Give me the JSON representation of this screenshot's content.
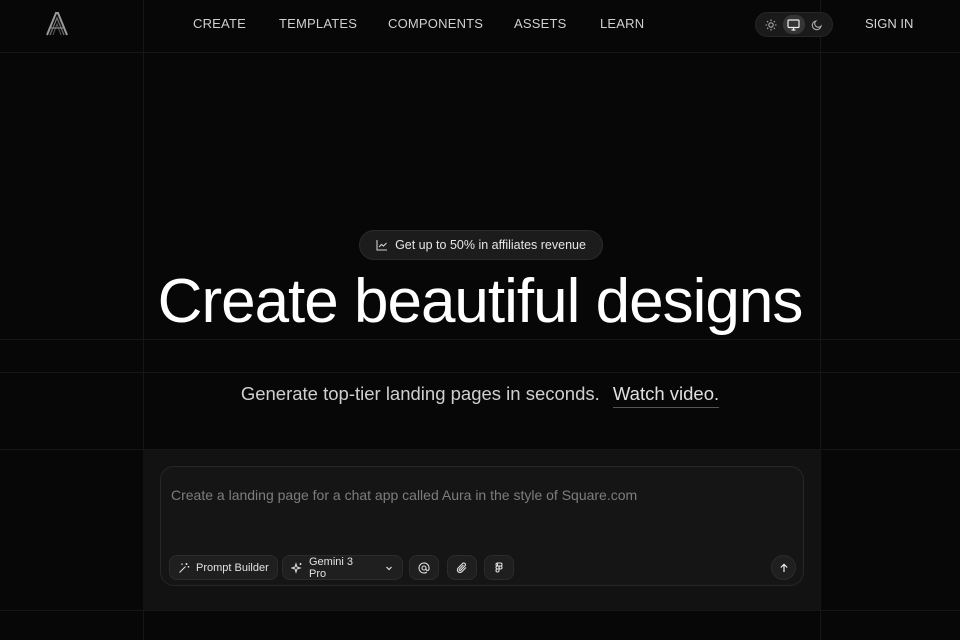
{
  "nav": {
    "items": [
      {
        "label": "CREATE"
      },
      {
        "label": "TEMPLATES"
      },
      {
        "label": "COMPONENTS"
      },
      {
        "label": "ASSETS"
      },
      {
        "label": "LEARN"
      }
    ],
    "signin_label": "SIGN IN",
    "theme_modes": [
      "sun-icon",
      "monitor-icon",
      "moon-icon"
    ],
    "active_theme": "monitor"
  },
  "hero": {
    "badge_text": "Get up to 50% in affiliates revenue",
    "badge_icon": "trending-chart-icon",
    "title": "Create beautiful designs",
    "subtitle": "Generate top-tier landing pages in seconds.",
    "watch_link": "Watch video."
  },
  "composer": {
    "placeholder": "Create a landing page for a chat app called Aura in the style of Square.com",
    "prompt_builder_label": "Prompt Builder",
    "model_label": "Gemini 3 Pro",
    "tools": [
      "mention-icon",
      "paperclip-icon",
      "figma-icon"
    ],
    "send_icon": "arrow-up-icon"
  },
  "colors": {
    "background": "#070707",
    "text_primary": "#ffffff",
    "text_muted": "#7d7d7d"
  }
}
